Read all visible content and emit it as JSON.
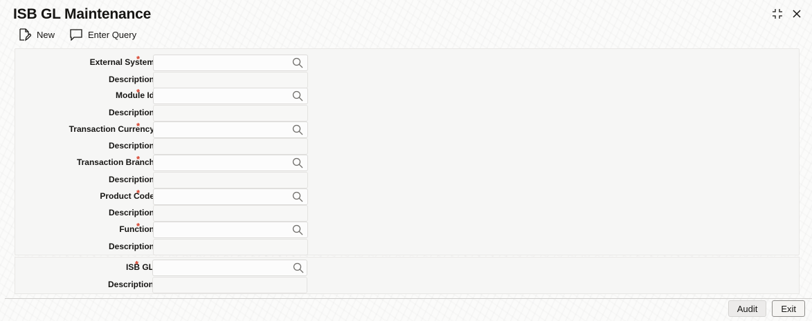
{
  "window": {
    "title": "ISB GL Maintenance"
  },
  "toolbar": {
    "new_label": "New",
    "enter_query_label": "Enter Query"
  },
  "form": {
    "required_marker": "*",
    "fields": [
      {
        "label": "External System",
        "value": "",
        "required": true,
        "lookup": true
      },
      {
        "label": "Description",
        "value": "",
        "required": false,
        "lookup": false
      },
      {
        "label": "Module Id",
        "value": "",
        "required": true,
        "lookup": true
      },
      {
        "label": "Description",
        "value": "",
        "required": false,
        "lookup": false
      },
      {
        "label": "Transaction Currency",
        "value": "",
        "required": true,
        "lookup": true
      },
      {
        "label": "Description",
        "value": "",
        "required": false,
        "lookup": false
      },
      {
        "label": "Transaction Branch",
        "value": "",
        "required": true,
        "lookup": true
      },
      {
        "label": "Description",
        "value": "",
        "required": false,
        "lookup": false
      },
      {
        "label": "Product Code",
        "value": "",
        "required": true,
        "lookup": true
      },
      {
        "label": "Description",
        "value": "",
        "required": false,
        "lookup": false
      },
      {
        "label": "Function",
        "value": "",
        "required": true,
        "lookup": true
      },
      {
        "label": "Description",
        "value": "",
        "required": false,
        "lookup": false
      }
    ],
    "isb_fields": [
      {
        "label": "ISB GL",
        "value": "",
        "required": true,
        "lookup": true
      },
      {
        "label": "Description",
        "value": "",
        "required": false,
        "lookup": false
      }
    ]
  },
  "footer": {
    "audit_label": "Audit",
    "exit_label": "Exit"
  },
  "colors": {
    "required": "#d63b25",
    "text": "#161513",
    "panel": "#f6f6f5"
  },
  "icons": {
    "new": "new-document-icon",
    "enter_query": "speech-bubble-icon",
    "lookup": "search-icon",
    "maximize": "maximize-icon",
    "close": "close-icon"
  }
}
